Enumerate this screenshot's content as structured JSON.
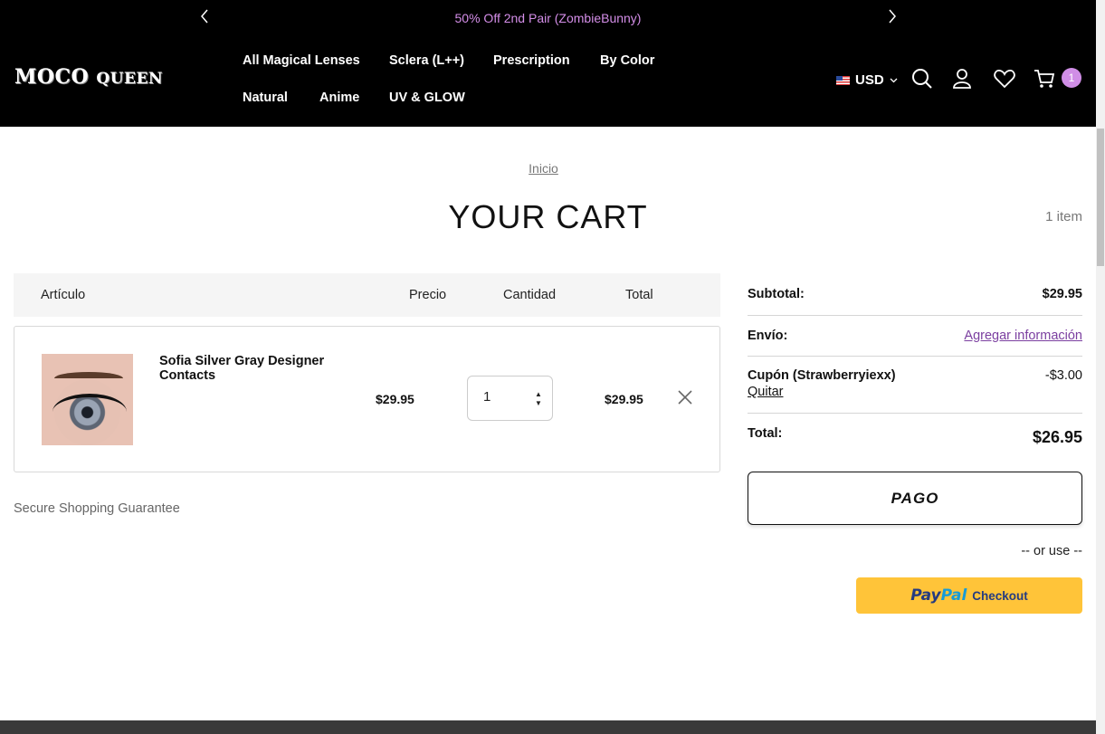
{
  "announcement": {
    "text": "50% Off 2nd Pair (ZombieBunny)"
  },
  "brand": {
    "logo_main": "MOCO",
    "logo_second": "QUEEN"
  },
  "nav": {
    "items": [
      "All Magical Lenses",
      "Sclera (L++)",
      "Prescription",
      "By Color",
      "Natural",
      "Anime",
      "UV & GLOW"
    ]
  },
  "header": {
    "currency": "USD",
    "cart_count": "1"
  },
  "page": {
    "breadcrumb": "Inicio",
    "title": "YOUR CART",
    "item_count": "1 item"
  },
  "table": {
    "headers": {
      "item": "Artículo",
      "price": "Precio",
      "quantity": "Cantidad",
      "total": "Total"
    }
  },
  "cart_items": [
    {
      "name": "Sofia Silver Gray Designer Contacts",
      "price": "$29.95",
      "quantity": "1",
      "total": "$29.95"
    }
  ],
  "secure_text": "Secure Shopping Guarantee",
  "summary": {
    "subtotal_label": "Subtotal:",
    "subtotal_value": "$29.95",
    "shipping_label": "Envío:",
    "shipping_link": "Agregar información",
    "coupon_label": "Cupón (Strawberryiexx)",
    "coupon_remove": "Quitar",
    "coupon_value": "-$3.00",
    "total_label": "Total:",
    "total_value": "$26.95",
    "checkout_label": "PAGO",
    "or_use": "-- or use --",
    "paypal_word1": "Pay",
    "paypal_word2": "Pal",
    "paypal_checkout": "Checkout"
  },
  "colors": {
    "accent": "#d08ee6",
    "link_purple": "#7b3fa0",
    "paypal_yellow": "#ffc439"
  }
}
